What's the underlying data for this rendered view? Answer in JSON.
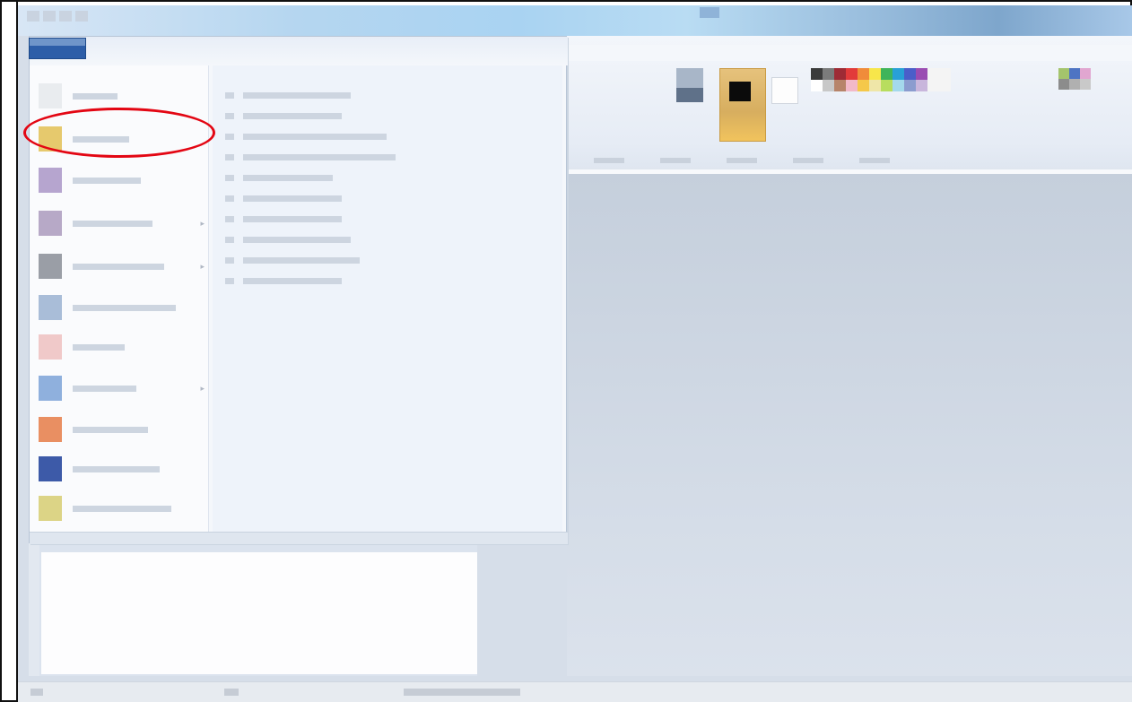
{
  "app": {
    "title": "",
    "qat_icons": [
      "save-icon",
      "undo-icon",
      "redo-icon",
      "customize-icon"
    ]
  },
  "app_menu": {
    "items": [
      {
        "name": "new",
        "label": "",
        "icon": "new-document-icon",
        "color": "#e9ecef",
        "has_arrow": false
      },
      {
        "name": "open",
        "label": "",
        "icon": "open-folder-icon",
        "color": "#e6c96d",
        "has_arrow": false
      },
      {
        "name": "save",
        "label": "",
        "icon": "save-icon",
        "color": "#b6a5cf",
        "has_arrow": false
      },
      {
        "name": "save-as",
        "label": "",
        "icon": "save-as-icon",
        "color": "#b7a9c7",
        "has_arrow": true
      },
      {
        "name": "print",
        "label": "",
        "icon": "print-icon",
        "color": "#9a9ea6",
        "has_arrow": true
      },
      {
        "name": "from-scanner",
        "label": "",
        "icon": "scanner-icon",
        "color": "#a9bdd8",
        "has_arrow": false
      },
      {
        "name": "send-email",
        "label": "",
        "icon": "email-icon",
        "color": "#f0c9c9",
        "has_arrow": false
      },
      {
        "name": "set-desktop",
        "label": "",
        "icon": "desktop-icon",
        "color": "#8fb0dd",
        "has_arrow": true
      },
      {
        "name": "properties",
        "label": "",
        "icon": "properties-icon",
        "color": "#e98f62",
        "has_arrow": false
      },
      {
        "name": "about",
        "label": "",
        "icon": "about-icon",
        "color": "#3d5aa8",
        "has_arrow": false
      },
      {
        "name": "exit",
        "label": "",
        "icon": "exit-icon",
        "color": "#dcd486",
        "has_arrow": false
      }
    ],
    "recent_title": "",
    "recent_items": [
      "",
      "",
      "",
      "",
      "",
      "",
      "",
      "",
      "",
      ""
    ]
  },
  "ribbon": {
    "colors_group_label": "",
    "color1_label": "",
    "palette": [
      "#3b3b3b",
      "#7b7b7b",
      "#9e2b35",
      "#e23a3a",
      "#f08c3a",
      "#f7e64a",
      "#3fb45a",
      "#28a0d6",
      "#4a5ec9",
      "#9a4cb2",
      "#f4f4f4",
      "#f4f4f4",
      "#ffffff",
      "#c8c8c8",
      "#b7846a",
      "#f2b9c9",
      "#f5c84a",
      "#efe6a8",
      "#b8dd5e",
      "#a4d9ec",
      "#8b9ccf",
      "#c9b6dc",
      "#f4f4f4",
      "#f4f4f4"
    ],
    "palette_extra": [
      "#a4c46c",
      "#4e74c3",
      "#e1a6d0",
      "#8c8c8c",
      "#b0b0b0",
      "#c9c9c9"
    ],
    "accent_color": "#e6c27c",
    "primary_color": "#0b0b0b",
    "secondary_color": "#ffffff"
  },
  "annotation": {
    "color": "#e30613"
  },
  "status": {
    "left": "",
    "middle": ""
  }
}
